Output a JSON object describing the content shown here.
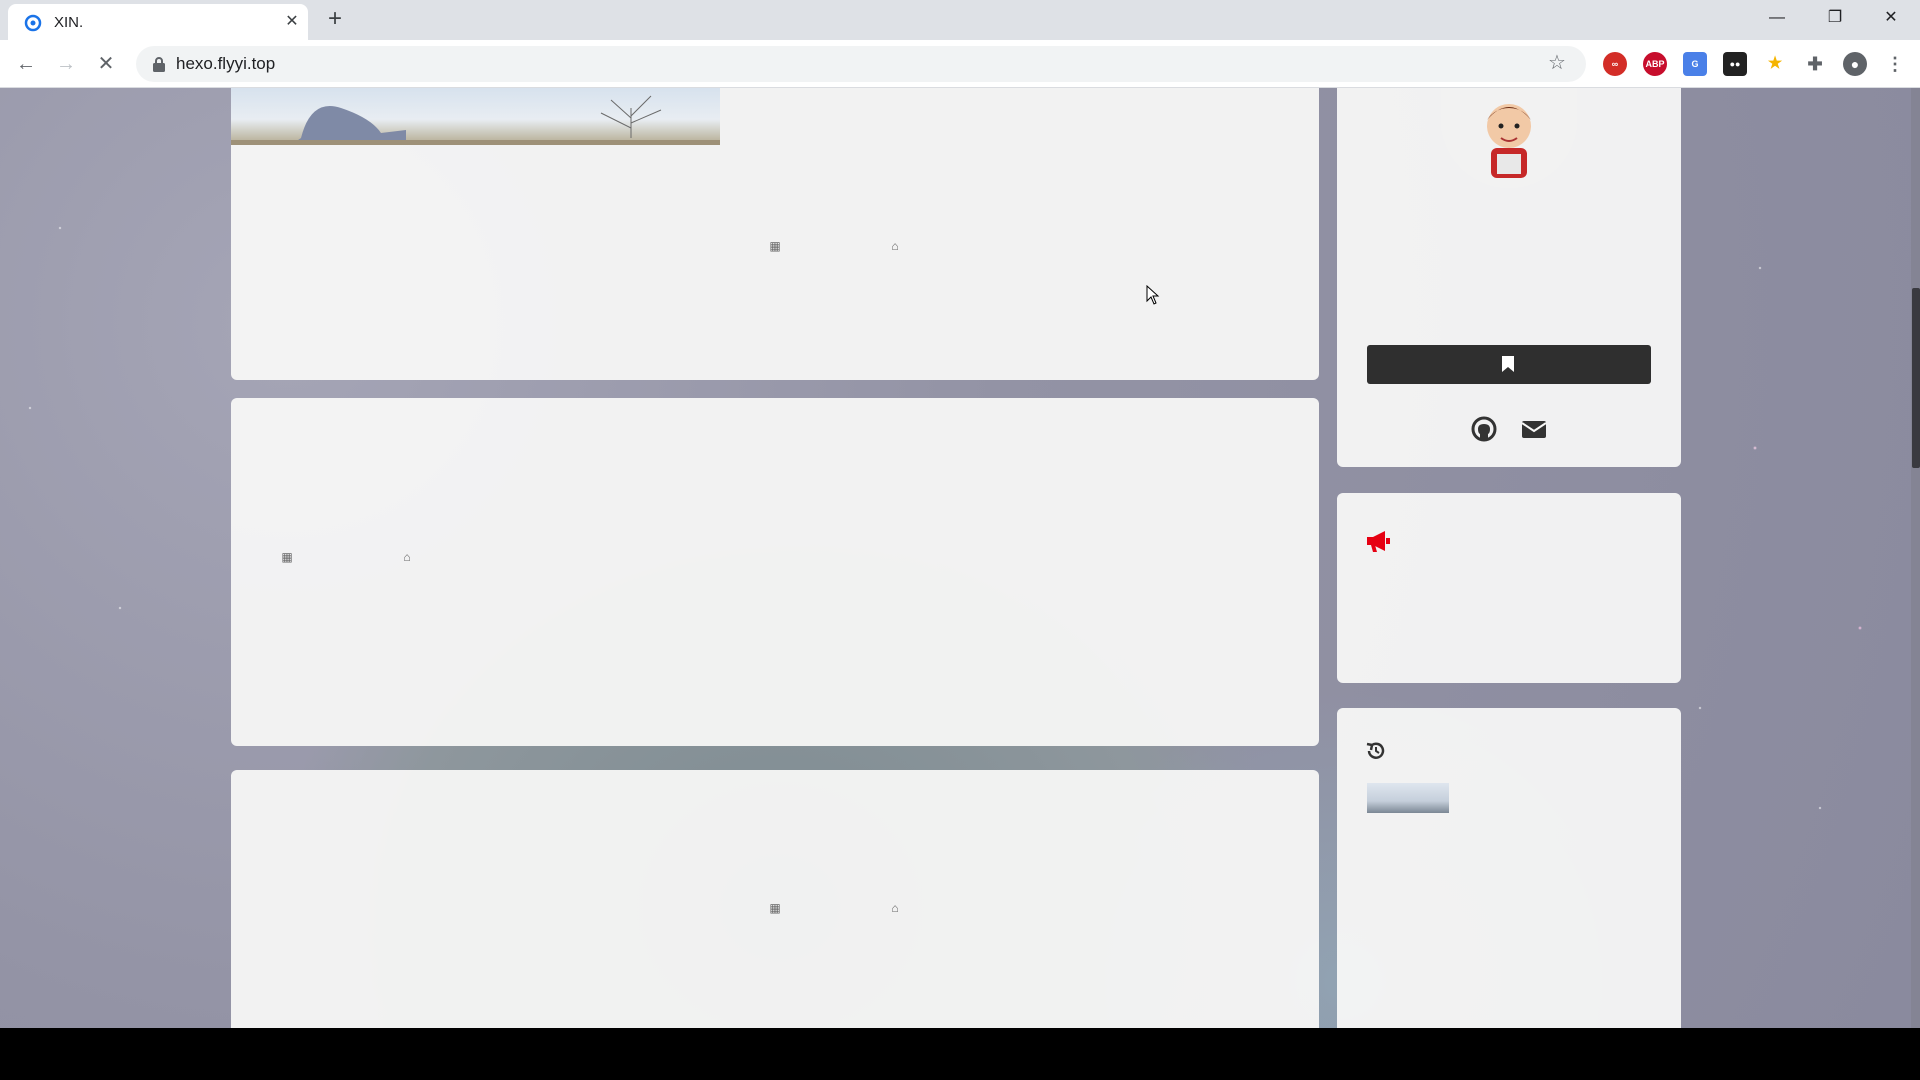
{
  "browser": {
    "tab_title": "XIN.",
    "url": "hexo.flyyi.top",
    "extensions": [
      {
        "name": "lastpass-extension-icon",
        "color": "#d32d27",
        "label": ""
      },
      {
        "name": "adblock-plus-extension-icon",
        "color": "#c70d2c",
        "label": "ABP"
      },
      {
        "name": "translate-extension-icon",
        "color": "#4a80e8",
        "label": ""
      },
      {
        "name": "tampermonkey-extension-icon",
        "color": "#222222",
        "label": ""
      },
      {
        "name": "bookmark-extension-icon",
        "color": "#f5b400",
        "label": ""
      }
    ]
  },
  "colors": {
    "accent": "#2f2f2f",
    "notice_icon": "#e60012"
  },
  "sidebar": {
    "profile": {
      "avatar_caption": "",
      "social": [
        "github-icon",
        "mail-icon"
      ]
    },
    "notice": {
      "icon": "megaphone-icon"
    },
    "recent": {
      "icon": "history-icon"
    }
  },
  "posts": [
    {
      "meta_icons": [
        "calendar-icon",
        "inbox-icon"
      ]
    },
    {
      "meta_icons": [
        "calendar-icon",
        "inbox-icon"
      ]
    },
    {
      "meta_icons": [
        "calendar-icon",
        "inbox-icon"
      ]
    }
  ]
}
